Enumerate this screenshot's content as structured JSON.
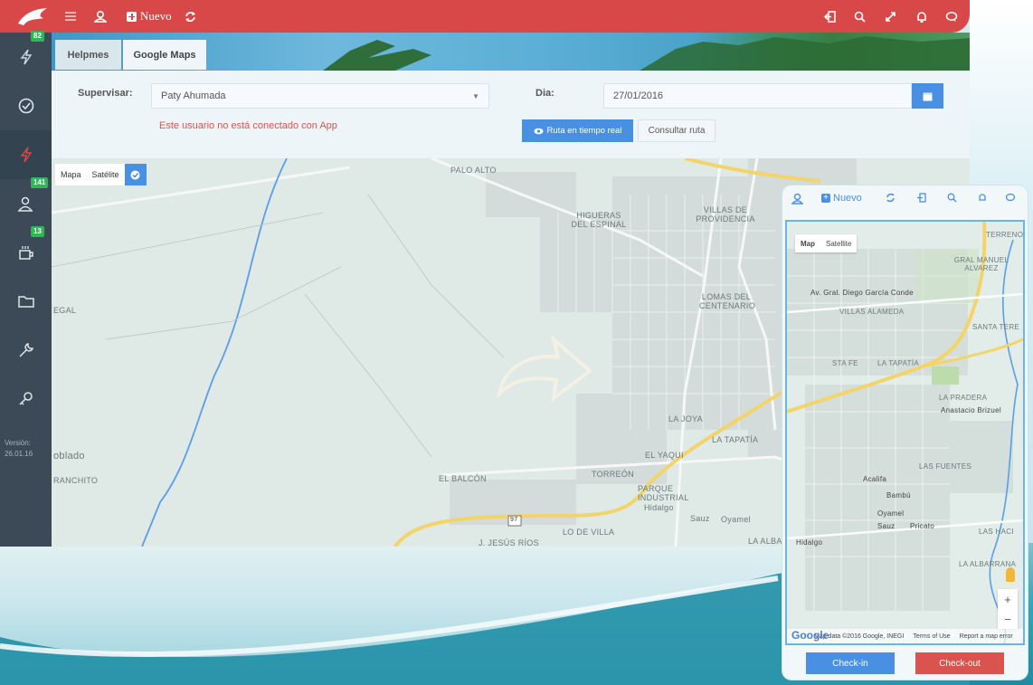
{
  "topbar": {
    "nuevo_label": "Nuevo",
    "icons": [
      "menu-icon",
      "user-icon",
      "refresh-icon",
      "logout-icon",
      "search-icon",
      "fullscreen-icon",
      "bell-icon",
      "chat-icon"
    ]
  },
  "sidebar": {
    "items": [
      {
        "icon": "bolt-icon",
        "badge": "82"
      },
      {
        "icon": "check-circle-icon",
        "badge": ""
      },
      {
        "icon": "bolt-icon",
        "badge": ""
      },
      {
        "icon": "users-icon",
        "badge": "141"
      },
      {
        "icon": "coffee-icon",
        "badge": "13"
      },
      {
        "icon": "folder-icon",
        "badge": ""
      },
      {
        "icon": "wrench-icon",
        "badge": ""
      },
      {
        "icon": "key-icon",
        "badge": ""
      }
    ],
    "version_label": "Versión:",
    "version_value": "26.01.16"
  },
  "tabs": [
    "Helpmes",
    "Google Maps"
  ],
  "form": {
    "supervisar_label": "Supervisar:",
    "supervisar_value": "Paty Ahumada",
    "dia_label": "Dia:",
    "dia_value": "27/01/2016",
    "warning": "Este usuario no está conectado con App",
    "realtime_button": "Ruta en tiempo real",
    "consult_button": "Consultar ruta"
  },
  "map": {
    "toggle_map": "Mapa",
    "toggle_satellite": "Satélite",
    "labels": {
      "palo_alto": "PALO ALTO",
      "higueras": "HIGUERAS DEL ESPINAL",
      "villas": "VILLAS DE PROVIDENCIA",
      "lomas": "LOMAS DEL CENTENARIO",
      "la_joya": "LA JOYA",
      "el_yaqui": "EL YAQUI",
      "torreon": "TORREÓN",
      "el_balcon": "EL BALCÓN",
      "parque": "PARQUE INDUSTRIAL",
      "jesus_rios": "J. JESÚS RÍOS",
      "lo_de_villa": "LO DE VILLA",
      "la_tapatia": "LA TAPATÍA",
      "poblado": "oblado",
      "ranchito": "RANCHITO",
      "egal": "EGAL",
      "hidalgo": "Hidalgo",
      "oyamel": "Oyamel",
      "sauz": "Sauz",
      "la_alba": "LA ALBA",
      "highway": "97"
    }
  },
  "phone": {
    "nuevo_label": "Nuevo",
    "toggle_map": "Map",
    "toggle_satellite": "Satellite",
    "labels": {
      "villas_alameda": "VILLAS ALAMEDA",
      "sta_fe": "STA FE",
      "la_tapatia": "LA TAPATÍA",
      "la_pradera": "LA PRADERA",
      "las_fuentes": "LAS FUENTES",
      "anastacio": "Anastacio Brizuel",
      "gral_manuel": "GRAL MANUEL ALVAREZ",
      "santa_tere": "SANTA TERE",
      "terreno": "TERRENO",
      "diego": "Av. Gral. Diego García Conde",
      "hidalgo": "Hidalgo",
      "la_albarrana": "LA ALBARRANA",
      "las_haci": "LAS HACI",
      "bambu": "Bambú",
      "oyamel": "Oyamel",
      "sauz": "Sauz",
      "pricato": "Pricato",
      "acalifa": "Acalifa"
    },
    "google": "Google",
    "attribution": "Map data ©2016 Google, INEGI",
    "terms": "Terms of Use",
    "report": "Report a map error",
    "zoom_in": "+",
    "zoom_out": "−",
    "checkin": "Check-in",
    "checkout": "Check-out"
  }
}
